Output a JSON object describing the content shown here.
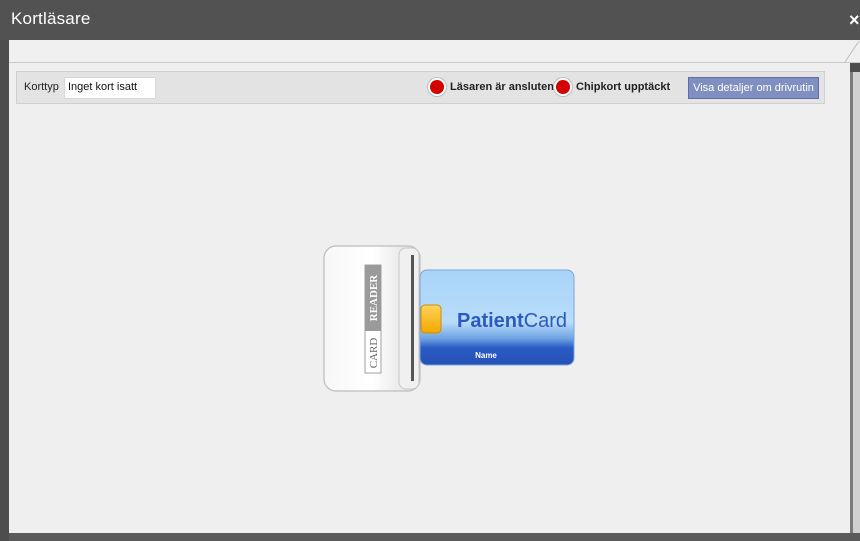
{
  "window": {
    "title": "Kortläsare",
    "close_glyph": "×"
  },
  "toolbar": {
    "card_type_label": "Korttyp",
    "card_type_value": "Inget kort isatt",
    "reader_status": "Läsaren är ansluten",
    "chip_status": "Chipkort upptäckt",
    "details_button": "Visa detaljer om drivrutin"
  },
  "illustration": {
    "reader_label": "READER",
    "card_label": "CARD",
    "card_brand_bold": "Patient",
    "card_brand_light": "Card",
    "card_name": "Name"
  },
  "icons": {
    "close": "close-icon",
    "status_reader": "red-status-dot-icon",
    "status_chip": "red-status-dot-icon"
  },
  "colors": {
    "status_red": "#d40000",
    "button_blue": "#7f8fc1",
    "card_blue": "#2a5bc4",
    "card_light": "#a8d4f8"
  }
}
